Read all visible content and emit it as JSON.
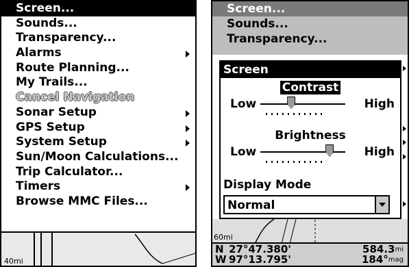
{
  "left_panel": {
    "menu_items": [
      {
        "label": "Screen...",
        "selected": true,
        "submenu": false
      },
      {
        "label": "Sounds...",
        "submenu": false
      },
      {
        "label": "Transparency...",
        "submenu": false
      },
      {
        "label": "Alarms",
        "submenu": true
      },
      {
        "label": "Route Planning...",
        "submenu": false
      },
      {
        "label": "My Trails...",
        "submenu": false
      },
      {
        "label": "Cancel Navigation",
        "disabled": true,
        "submenu": false
      },
      {
        "label": "Sonar Setup",
        "submenu": true
      },
      {
        "label": "GPS Setup",
        "submenu": true
      },
      {
        "label": "System Setup",
        "submenu": true
      },
      {
        "label": "Sun/Moon Calculations...",
        "submenu": false
      },
      {
        "label": "Trip Calculator...",
        "submenu": false
      },
      {
        "label": "Timers",
        "submenu": true
      },
      {
        "label": "Browse MMC Files...",
        "submenu": false
      }
    ],
    "map_scale": "40mi"
  },
  "right_panel": {
    "menu_items": [
      "Screen...",
      "Sounds...",
      "Transparency..."
    ],
    "dialog": {
      "title": "Screen",
      "contrast": {
        "label": "Contrast",
        "low": "Low",
        "high": "High",
        "level": 0.35
      },
      "brightness": {
        "label": "Brightness",
        "low": "Low",
        "high": "High",
        "level": 0.85
      },
      "display_mode_label": "Display Mode",
      "display_mode_value": "Normal"
    },
    "map_scale": "60mi",
    "coords": {
      "lat_dir": "N",
      "lat": "27°47.380'",
      "lon_dir": "W",
      "lon": "97°13.795'",
      "distance": "584.3",
      "distance_unit": "mi",
      "bearing": "184°",
      "bearing_unit": "mag"
    }
  },
  "colors": {
    "selected_bg": "#000000",
    "dialog_bg": "#ffffff",
    "menu_dim_bg": "#bdbdbd"
  }
}
